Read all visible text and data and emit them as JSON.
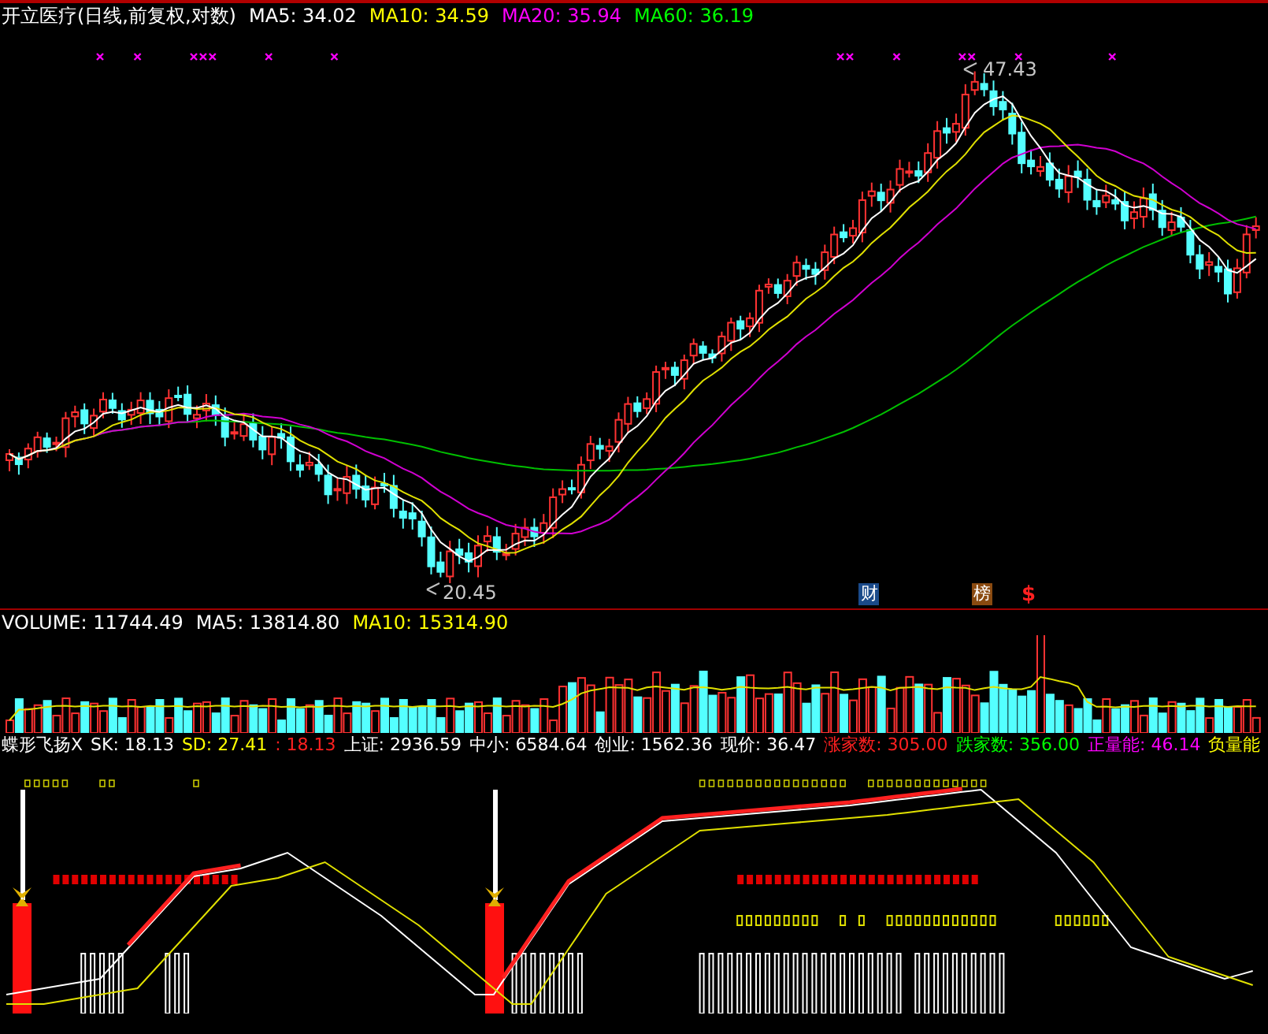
{
  "price_panel": {
    "title": "开立医疗(日线,前复权,对数)",
    "legend": [
      {
        "text": "MA5: 34.02",
        "color": "#ffffff"
      },
      {
        "text": "MA10: 34.59",
        "color": "#ffff00"
      },
      {
        "text": "MA20: 35.94",
        "color": "#ff00ff"
      },
      {
        "text": "MA60: 36.19",
        "color": "#00ff00"
      }
    ],
    "high_label": "47.43",
    "low_label": "20.45",
    "event_marks": [
      {
        "text": "财",
        "kind": "badge",
        "color": "#1a4a8a"
      },
      {
        "text": "榜",
        "kind": "badge",
        "color": "#8a4a10"
      },
      {
        "text": "$",
        "kind": "symbol",
        "color": "#ff2020"
      }
    ]
  },
  "volume_panel": {
    "legend": [
      {
        "text": "VOLUME: 11744.49",
        "color": "#ffffff"
      },
      {
        "text": "MA5: 13814.80",
        "color": "#ffffff"
      },
      {
        "text": "MA10: 15314.90",
        "color": "#ffff00"
      }
    ]
  },
  "indicator_panel": {
    "legend": [
      {
        "text": "蝶形飞扬X",
        "color": "#ffffff"
      },
      {
        "text": "SK: 18.13",
        "color": "#ffffff"
      },
      {
        "text": "SD: 27.41",
        "color": "#ffff00"
      },
      {
        "text": ": 18.13",
        "color": "#ff2020"
      },
      {
        "text": "上证: 2936.59",
        "color": "#ffffff"
      },
      {
        "text": "中小: 6584.64",
        "color": "#ffffff"
      },
      {
        "text": "创业: 1562.36",
        "color": "#ffffff"
      },
      {
        "text": "现价: 36.47",
        "color": "#ffffff"
      },
      {
        "text": "涨家数: 305.00",
        "color": "#ff2020"
      },
      {
        "text": "跌家数: 356.00",
        "color": "#00ff00"
      },
      {
        "text": "正量能: 46.14",
        "color": "#ff00ff"
      },
      {
        "text": "负量能",
        "color": "#ffff00"
      }
    ]
  }
}
